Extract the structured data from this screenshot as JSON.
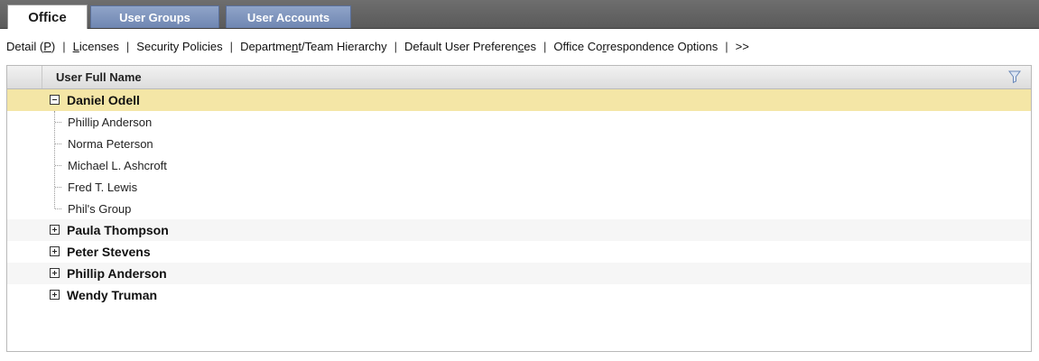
{
  "tabs": [
    {
      "label": "Office",
      "active": true
    },
    {
      "label": "User Groups",
      "active": false
    },
    {
      "label": "User Accounts",
      "active": false
    }
  ],
  "subnav": {
    "items": [
      {
        "pre": "Detail (",
        "u": "P",
        "post": ")"
      },
      {
        "pre": "",
        "u": "L",
        "post": "icenses"
      },
      {
        "pre": "Security Policies",
        "u": "",
        "post": ""
      },
      {
        "pre": "Departme",
        "u": "n",
        "post": "t/Team Hierarchy"
      },
      {
        "pre": "Default User Preferen",
        "u": "c",
        "post": "es"
      },
      {
        "pre": "Office Co",
        "u": "r",
        "post": "respondence Options"
      },
      {
        "pre": ">>",
        "u": "",
        "post": ""
      }
    ],
    "separator": "|"
  },
  "grid": {
    "column_header": "User Full Name",
    "filter_icon": "filter-icon",
    "groups": [
      {
        "name": "Daniel Odell",
        "expanded": true,
        "selected": true,
        "children": [
          "Phillip Anderson",
          "Norma Peterson",
          "Michael L. Ashcroft",
          "Fred T. Lewis",
          "Phil's Group"
        ]
      },
      {
        "name": "Paula Thompson",
        "expanded": false
      },
      {
        "name": "Peter Stevens",
        "expanded": false
      },
      {
        "name": "Phillip Anderson",
        "expanded": false
      },
      {
        "name": "Wendy Truman",
        "expanded": false
      }
    ]
  },
  "colors": {
    "selected_row": "#f4e6a6",
    "tab_inactive": "#7a8fbb",
    "tabbar": "#606060"
  }
}
